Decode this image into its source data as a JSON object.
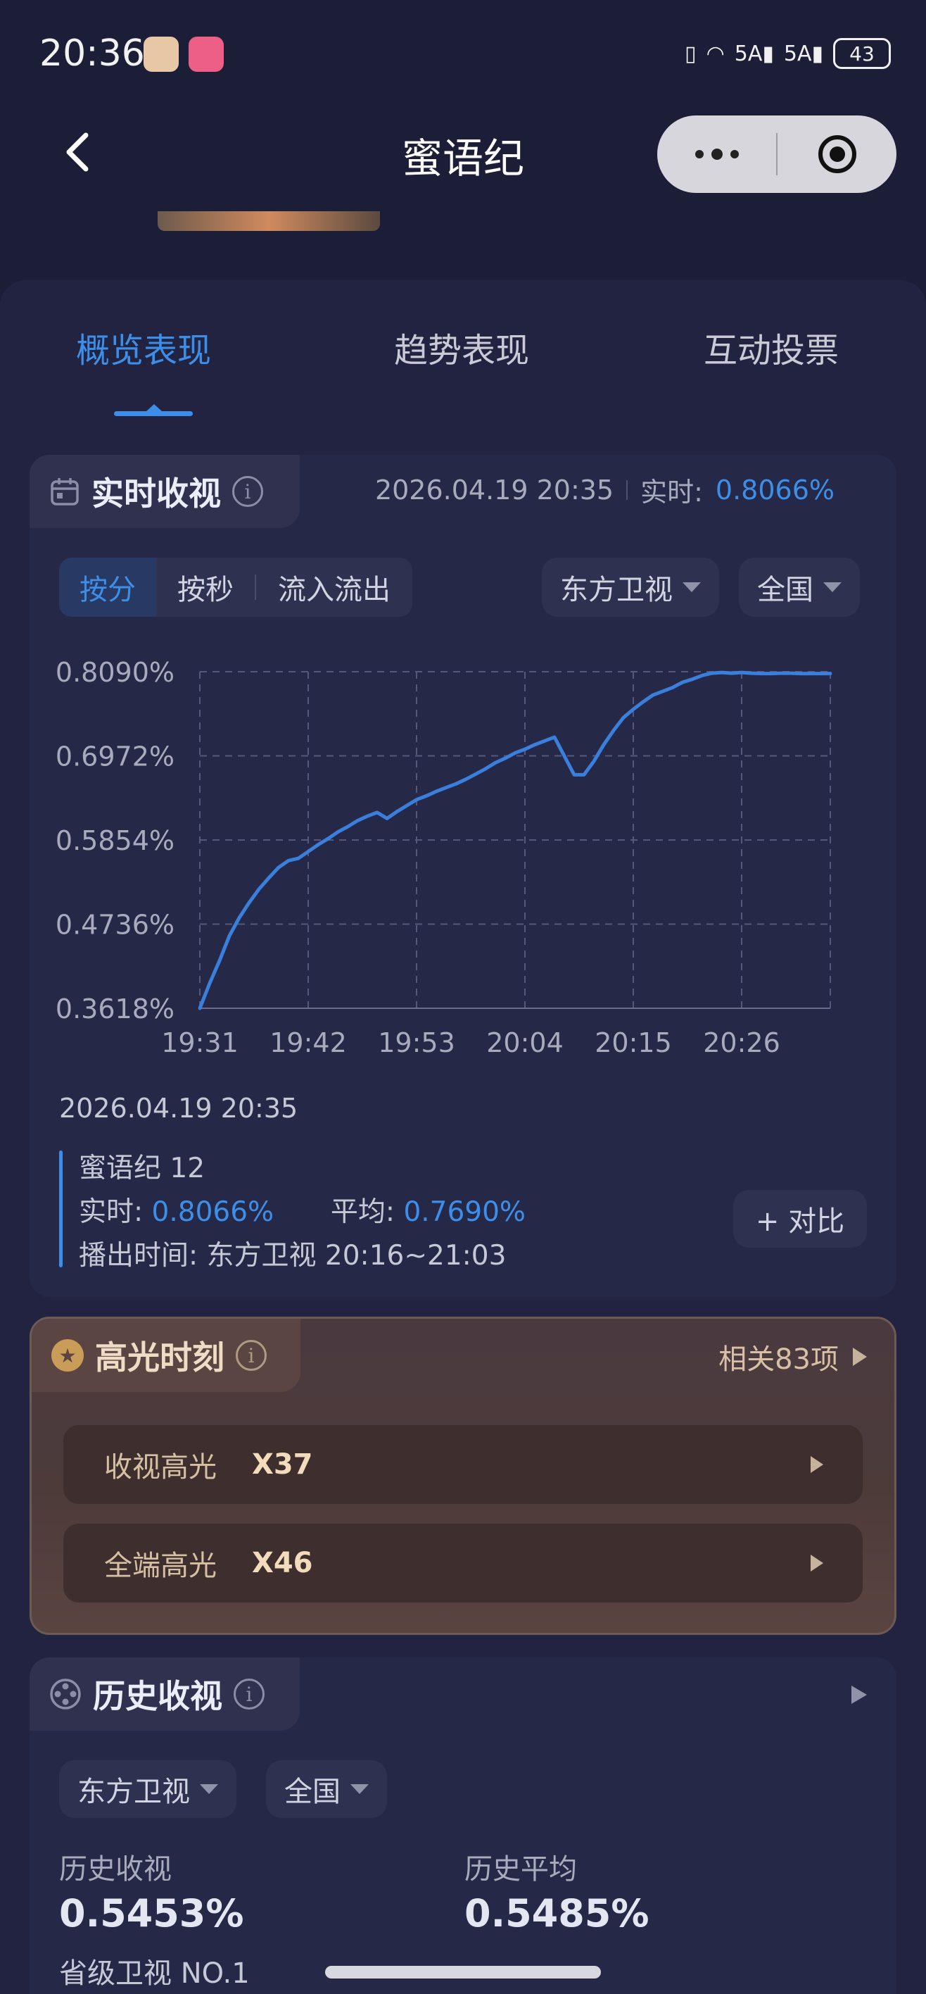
{
  "status_bar": {
    "time": "20:36",
    "network": "5A",
    "battery": "43"
  },
  "nav": {
    "title": "蜜语纪"
  },
  "tabs": [
    {
      "label": "概览表现",
      "active": true
    },
    {
      "label": "趋势表现",
      "active": false
    },
    {
      "label": "互动投票",
      "active": false
    }
  ],
  "realtime": {
    "title": "实时收视",
    "timestamp": "2026.04.19 20:35",
    "rating_label": "实时:",
    "rating_value": "0.8066%",
    "segments": [
      "按分",
      "按秒",
      "流入流出"
    ],
    "active_segment": "按分",
    "channel": "东方卫视",
    "region": "全国"
  },
  "chart_data": {
    "type": "line",
    "x_ticks": [
      "19:31",
      "19:42",
      "19:53",
      "20:04",
      "20:15",
      "20:26"
    ],
    "y_ticks": [
      "0.8090%",
      "0.6972%",
      "0.5854%",
      "0.4736%",
      "0.3618%"
    ],
    "ylim": [
      0.3618,
      0.809
    ],
    "grid": true,
    "series": [
      {
        "name": "蜜语纪",
        "color": "#3a7fdc",
        "x": [
          "19:31",
          "19:32",
          "19:33",
          "19:34",
          "19:35",
          "19:36",
          "19:37",
          "19:38",
          "19:39",
          "19:40",
          "19:41",
          "19:42",
          "19:43",
          "19:44",
          "19:45",
          "19:46",
          "19:47",
          "19:48",
          "19:49",
          "19:50",
          "19:51",
          "19:52",
          "19:53",
          "19:54",
          "19:55",
          "19:56",
          "19:57",
          "19:58",
          "19:59",
          "20:00",
          "20:01",
          "20:02",
          "20:03",
          "20:04",
          "20:05",
          "20:06",
          "20:07",
          "20:08",
          "20:09",
          "20:10",
          "20:11",
          "20:12",
          "20:13",
          "20:14",
          "20:15",
          "20:16",
          "20:17",
          "20:18",
          "20:19",
          "20:20",
          "20:21",
          "20:22",
          "20:23",
          "20:24",
          "20:25",
          "20:26",
          "20:27",
          "20:28",
          "20:29",
          "20:30",
          "20:31",
          "20:32",
          "20:33",
          "20:34",
          "20:35"
        ],
        "y": [
          0.3618,
          0.395,
          0.425,
          0.458,
          0.482,
          0.502,
          0.52,
          0.535,
          0.549,
          0.558,
          0.561,
          0.57,
          0.579,
          0.587,
          0.596,
          0.603,
          0.611,
          0.617,
          0.622,
          0.614,
          0.623,
          0.631,
          0.639,
          0.644,
          0.65,
          0.655,
          0.66,
          0.666,
          0.673,
          0.68,
          0.688,
          0.694,
          0.701,
          0.706,
          0.712,
          0.717,
          0.722,
          0.697,
          0.672,
          0.672,
          0.69,
          0.712,
          0.731,
          0.748,
          0.759,
          0.769,
          0.778,
          0.783,
          0.788,
          0.795,
          0.799,
          0.804,
          0.807,
          0.808,
          0.807,
          0.808,
          0.807,
          0.8066,
          0.8066,
          0.807,
          0.807,
          0.8066,
          0.8066,
          0.8066,
          0.8066
        ]
      }
    ]
  },
  "detail": {
    "date": "2026.04.19 20:35",
    "program": "蜜语纪 12",
    "realtime_label": "实时:",
    "realtime_value": "0.8066%",
    "average_label": "平均:",
    "average_value": "0.7690%",
    "airtime": "播出时间:  东方卫视 20:16~21:03",
    "compare_button": "+ 对比"
  },
  "highlights": {
    "title": "高光时刻",
    "related": "相关83项",
    "rows": [
      {
        "label": "收视高光",
        "value": "X37"
      },
      {
        "label": "全端高光",
        "value": "X46"
      }
    ]
  },
  "history": {
    "title": "历史收视",
    "channel": "东方卫视",
    "region": "全国",
    "rating_label": "历史收视",
    "rating_value": "0.5453%",
    "avg_label": "历史平均",
    "avg_value": "0.5485%",
    "rank": "省级卫视 NO.1"
  }
}
